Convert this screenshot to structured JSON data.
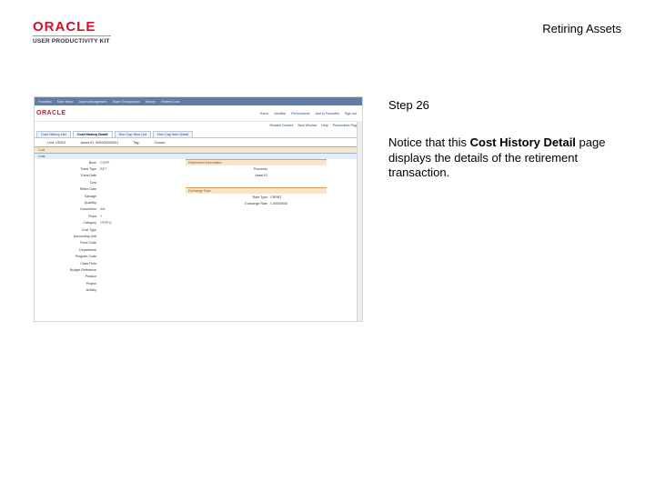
{
  "header": {
    "logo_oracle": "ORACLE",
    "logo_sub": "USER PRODUCTIVITY KIT",
    "title": "Retiring Assets"
  },
  "step": {
    "title": "Step 26",
    "text_before": "Notice that this ",
    "highlight": "Cost History Detail",
    "text_after": " page displays the details of the retirement transaction."
  },
  "screenshot": {
    "logo": "ORACLE",
    "menubar": [
      "Favorites",
      "Main Menu",
      "Asset Management",
      "Asset Transactions",
      "History",
      "Review Cost"
    ],
    "top_links": [
      "Home",
      "Worklist",
      "Performance",
      "Add to Favorites",
      "Sign out"
    ],
    "nav_links": [
      "Related Content",
      "New Window",
      "Help",
      "Personalize Page"
    ],
    "tabs": [
      {
        "label": "Cost History List",
        "active": false
      },
      {
        "label": "Cost History Detail",
        "active": true
      },
      {
        "label": "Non Cap Item List",
        "active": false
      },
      {
        "label": "Non Cap Item Detail",
        "active": false
      }
    ],
    "key_row": [
      "Unit: US001",
      "Asset ID: 000000000001",
      "Tag:",
      "Closed"
    ],
    "sections": {
      "cost": "Cost",
      "cost_row": "Cost",
      "info": "Retirement Information",
      "exchange": "Exchange Rate"
    },
    "left_fields": [
      {
        "label": "Book",
        "value": "CORP"
      },
      {
        "label": "Trans Type",
        "value": "RET"
      },
      {
        "label": "Trans Date",
        "value": ""
      },
      {
        "label": "Cost",
        "value": ""
      },
      {
        "label": "Retire Date",
        "value": ""
      },
      {
        "label": "Salvage",
        "value": ""
      },
      {
        "label": "Quantity",
        "value": ""
      },
      {
        "label": "Convention",
        "value": "AM"
      },
      {
        "label": "Fixed",
        "value": "Y"
      },
      {
        "label": "Category",
        "value": "OFFEQ"
      },
      {
        "label": "Cost Type",
        "value": ""
      },
      {
        "label": "Accounting Unit",
        "value": ""
      },
      {
        "label": "Fund Code",
        "value": ""
      },
      {
        "label": "Department",
        "value": ""
      },
      {
        "label": "Program Code",
        "value": ""
      },
      {
        "label": "Class Field",
        "value": ""
      },
      {
        "label": "Budget Reference",
        "value": ""
      },
      {
        "label": "Product",
        "value": ""
      },
      {
        "label": "Project",
        "value": ""
      },
      {
        "label": "Activity",
        "value": ""
      }
    ],
    "right_rows": [
      {
        "label": "Proceeds",
        "value": ""
      },
      {
        "label": "Asset ID",
        "value": ""
      },
      {
        "label": "Rate Type",
        "value": "CRRNT"
      },
      {
        "label": "Exchange Rate",
        "value": "1.00000000"
      }
    ]
  }
}
